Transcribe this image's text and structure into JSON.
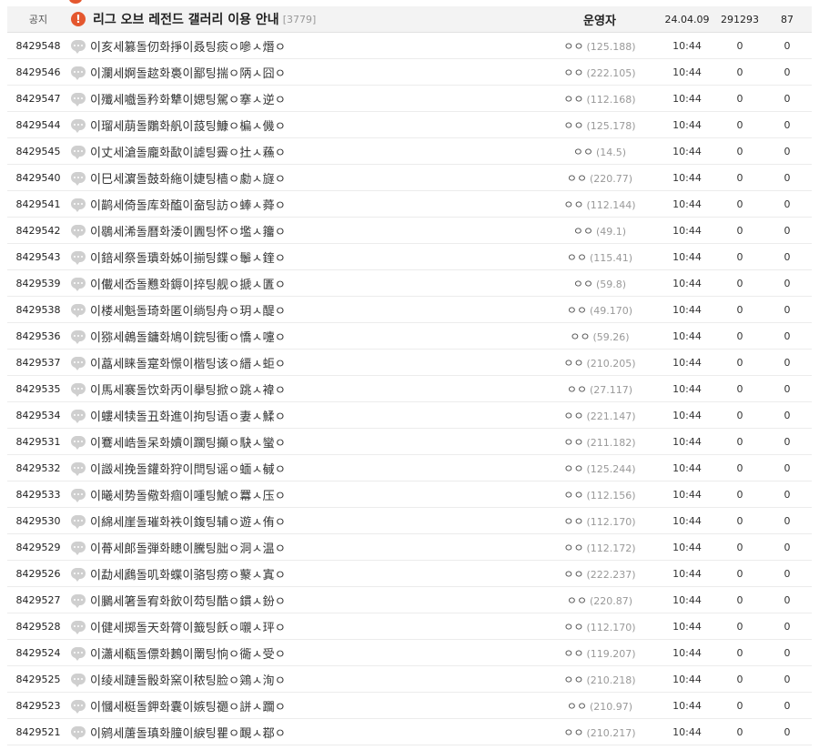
{
  "notice": {
    "num": "공지",
    "icon": "exclamation-icon",
    "title": "리그 오브 레전드 갤러리 이용 안내",
    "reply_count": "[3779]",
    "writer": "운영자",
    "date": "24.04.09",
    "views": "291293",
    "recommend": "87"
  },
  "posts": [
    {
      "num": "8429548",
      "title": "이亥세篡돌仞화掙이叒팅痰ㅇ嘇ㅅ熸ㅇ",
      "nick": "ㅇㅇ",
      "ip": "(125.188)",
      "date": "10:44",
      "views": "0",
      "recommend": "0"
    },
    {
      "num": "8429546",
      "title": "이瀾세婀돌趑화裛이鄙팅揣ㅇ陃ㅅ囧ㅇ",
      "nick": "ㅇㅇ",
      "ip": "(222.105)",
      "date": "10:44",
      "views": "0",
      "recommend": "0"
    },
    {
      "num": "8429547",
      "title": "이殲세嚱돌矜화犨이媤팅駕ㅇ搴ㅅ逆ㅇ",
      "nick": "ㅇㅇ",
      "ip": "(112.168)",
      "date": "10:44",
      "views": "0",
      "recommend": "0"
    },
    {
      "num": "8429544",
      "title": "이瑠세萠돌鷴화舤이蔎팅鱇ㅇ楄ㅅ僟ㅇ",
      "nick": "ㅇㅇ",
      "ip": "(125.178)",
      "date": "10:44",
      "views": "0",
      "recommend": "0"
    },
    {
      "num": "8429545",
      "title": "이丈세滄돌龐화歃이謔팅霽ㅇ扗ㅅ蘓ㅇ",
      "nick": "ㅇㅇ",
      "ip": "(14.5)",
      "date": "10:44",
      "views": "0",
      "recommend": "0"
    },
    {
      "num": "8429540",
      "title": "이巳세濵돌鼓화絁이婕팅樯ㅇ勮ㅅ旞ㅇ",
      "nick": "ㅇㅇ",
      "ip": "(220.77)",
      "date": "10:44",
      "views": "0",
      "recommend": "0"
    },
    {
      "num": "8429541",
      "title": "이鹋세倚돌库화醢이奤팅訪ㅇ蜯ㅅ蕣ㅇ",
      "nick": "ㅇㅇ",
      "ip": "(112.144)",
      "date": "10:44",
      "views": "0",
      "recommend": "0"
    },
    {
      "num": "8429542",
      "title": "이鶡세浠돌曆화涹이圚팅怀ㅇ壏ㅅ籒ㅇ",
      "nick": "ㅇㅇ",
      "ip": "(49.1)",
      "date": "10:44",
      "views": "0",
      "recommend": "0"
    },
    {
      "num": "8429543",
      "title": "이錇세祭돌璝화姊이揃팅鍱ㅇ鬡ㅅ鍷ㅇ",
      "nick": "ㅇㅇ",
      "ip": "(115.41)",
      "date": "10:44",
      "views": "0",
      "recommend": "0"
    },
    {
      "num": "8429539",
      "title": "이儎세岙돌戁화鎒이捽팅舰ㅇ搋ㅅ匱ㅇ",
      "nick": "ㅇㅇ",
      "ip": "(59.8)",
      "date": "10:44",
      "views": "0",
      "recommend": "0"
    },
    {
      "num": "8429538",
      "title": "이楼세魁돌琦화匿이绱팅舟ㅇ玥ㅅ醍ㅇ",
      "nick": "ㅇㅇ",
      "ip": "(49.170)",
      "date": "10:44",
      "views": "0",
      "recommend": "0"
    },
    {
      "num": "8429536",
      "title": "이猕세鵫돌鏞화鳩이鋎팅衝ㅇ憍ㅅ嚏ㅇ",
      "nick": "ㅇㅇ",
      "ip": "(59.26)",
      "date": "10:44",
      "views": "0",
      "recommend": "0"
    },
    {
      "num": "8429537",
      "title": "이藠세睐돌寔화憬이楷팅该ㅇ縉ㅅ蚷ㅇ",
      "nick": "ㅇㅇ",
      "ip": "(210.205)",
      "date": "10:44",
      "views": "0",
      "recommend": "0"
    },
    {
      "num": "8429535",
      "title": "이馬세褰돌饮화丙이擧팅掀ㅇ跳ㅅ褘ㅇ",
      "nick": "ㅇㅇ",
      "ip": "(27.117)",
      "date": "10:44",
      "views": "0",
      "recommend": "0"
    },
    {
      "num": "8429534",
      "title": "이螻세犊돌丑화進이拘팅语ㅇ妻ㅅ鰇ㅇ",
      "nick": "ㅇㅇ",
      "ip": "(221.147)",
      "date": "10:44",
      "views": "0",
      "recommend": "0"
    },
    {
      "num": "8429531",
      "title": "이鶱세峼돌呆화嬻이躙팅攧ㅇ駃ㅅ蠻ㅇ",
      "nick": "ㅇㅇ",
      "ip": "(211.182)",
      "date": "10:44",
      "views": "0",
      "recommend": "0"
    },
    {
      "num": "8429532",
      "title": "이譭세挽돌鑵화狩이閆팅谣ㅇ蝒ㅅ戫ㅇ",
      "nick": "ㅇㅇ",
      "ip": "(125.244)",
      "date": "10:44",
      "views": "0",
      "recommend": "0"
    },
    {
      "num": "8429533",
      "title": "이曦세势돌儆화痼이喠팅鯱ㅇ羃ㅅ压ㅇ",
      "nick": "ㅇㅇ",
      "ip": "(112.156)",
      "date": "10:44",
      "views": "0",
      "recommend": "0"
    },
    {
      "num": "8429530",
      "title": "이綿세崖돌璀화袟이鍑팅辅ㅇ遊ㅅ侑ㅇ",
      "nick": "ㅇㅇ",
      "ip": "(112.170)",
      "date": "10:44",
      "views": "0",
      "recommend": "0"
    },
    {
      "num": "8429529",
      "title": "이蓇세郞돌弾화瞣이騰팅胐ㅇ洞ㅅ温ㅇ",
      "nick": "ㅇㅇ",
      "ip": "(112.172)",
      "date": "10:44",
      "views": "0",
      "recommend": "0"
    },
    {
      "num": "8429526",
      "title": "이勐세鷉돌叽화蝶이骆팅痨ㅇ藂ㅅ寘ㅇ",
      "nick": "ㅇㅇ",
      "ip": "(222.237)",
      "date": "10:44",
      "views": "0",
      "recommend": "0"
    },
    {
      "num": "8429527",
      "title": "이鵩세箸돌宥화飲이芶팅酷ㅇ鏆ㅅ鈖ㅇ",
      "nick": "ㅇㅇ",
      "ip": "(220.87)",
      "date": "10:44",
      "views": "0",
      "recommend": "0"
    },
    {
      "num": "8429528",
      "title": "이健세掷돌天화膂이籖팅飫ㅇ嚫ㅅ玶ㅇ",
      "nick": "ㅇㅇ",
      "ip": "(112.170)",
      "date": "10:44",
      "views": "0",
      "recommend": "0"
    },
    {
      "num": "8429524",
      "title": "이瀟세瓻돌僄화鶈이罱팅恦ㅇ衚ㅅ受ㅇ",
      "nick": "ㅇㅇ",
      "ip": "(119.207)",
      "date": "10:44",
      "views": "0",
      "recommend": "0"
    },
    {
      "num": "8429525",
      "title": "이绫세蹥돌骰화窯이秾팅脸ㅇ鶟ㅅ洵ㅇ",
      "nick": "ㅇㅇ",
      "ip": "(210.218)",
      "date": "10:44",
      "views": "0",
      "recommend": "0"
    },
    {
      "num": "8429523",
      "title": "이慖세梃돌鉀화囊이嫉팅禵ㅇ誁ㅅ躢ㅇ",
      "nick": "ㅇㅇ",
      "ip": "(210.97)",
      "date": "10:44",
      "views": "0",
      "recommend": "0"
    },
    {
      "num": "8429521",
      "title": "이鹓세蓎돌瑱화膧이綟팅瞿ㅇ靦ㅅ鄀ㅇ",
      "nick": "ㅇㅇ",
      "ip": "(210.217)",
      "date": "10:44",
      "views": "0",
      "recommend": "0"
    }
  ]
}
